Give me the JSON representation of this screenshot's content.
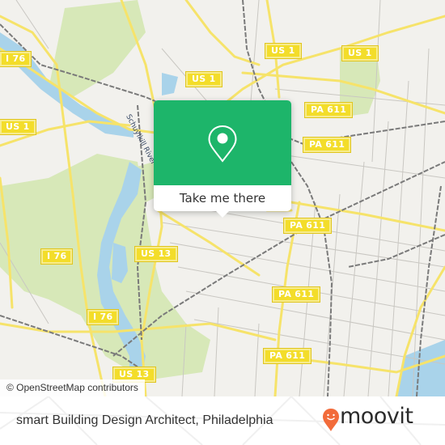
{
  "map": {
    "attribution": "© OpenStreetMap contributors",
    "river_label": "Schuylkill River",
    "route_shields": [
      {
        "label": "I 76"
      },
      {
        "label": "US 1"
      },
      {
        "label": "US 1"
      },
      {
        "label": "US 1"
      },
      {
        "label": "US 1"
      },
      {
        "label": "PA 611"
      },
      {
        "label": "PA 611"
      },
      {
        "label": "PA 611"
      },
      {
        "label": "PA 611"
      },
      {
        "label": "PA 611"
      },
      {
        "label": "I 76"
      },
      {
        "label": "US 13"
      },
      {
        "label": "I 76"
      },
      {
        "label": "US 13"
      }
    ],
    "colors": {
      "background": "#f2f1ed",
      "park": "#d7e8b8",
      "water": "#a9d3ea",
      "major_road": "#f6e36a",
      "rail": "#7a7a7a"
    }
  },
  "popup": {
    "button_label": "Take me there",
    "icon": "map-pin-icon",
    "color": "#1db56a"
  },
  "footer": {
    "place_title": "smart Building Design Architect, Philadelphia",
    "brand": "moovit",
    "brand_color": "#f26b3a"
  }
}
